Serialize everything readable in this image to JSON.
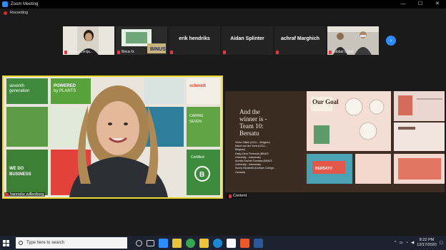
{
  "window": {
    "title": "Zoom Meeting",
    "controls": [
      "—",
      "☐",
      "✕"
    ]
  },
  "recording": {
    "label": "Recording"
  },
  "participants": [
    {
      "name": "Amelia Limija...",
      "type": "video"
    },
    {
      "name": "Binus fx",
      "type": "video"
    },
    {
      "name": "erik hendriks",
      "type": "name"
    },
    {
      "name": "Aidan Splinter",
      "type": "name"
    },
    {
      "name": "achraf Marghich",
      "type": "name"
    },
    {
      "name": "Global Class",
      "type": "video"
    }
  ],
  "speaker": {
    "name": "hanneke willenborg"
  },
  "content": {
    "label": "Content",
    "slide": {
      "heading": [
        "And the",
        "winner is -",
        "Team 10:",
        "Bersatu"
      ],
      "members": [
        "Victor Gillain (UCLL - Belgium)",
        "Maud van der Vorst (UCLL -",
        "Belgium)",
        "Daisy Dera Florencia (BINUS",
        "University - Indonesia)",
        "Aurelia Rachel Sumawa (BINUS",
        "University - Indonesia)",
        "Sunny Elizabeth (Durham College -",
        "Canada)"
      ],
      "thumb_title": "Our Goal"
    }
  },
  "taskbar": {
    "search_placeholder": "Type here to search",
    "time": "8:22 PM",
    "date": "12/17/2020"
  }
}
